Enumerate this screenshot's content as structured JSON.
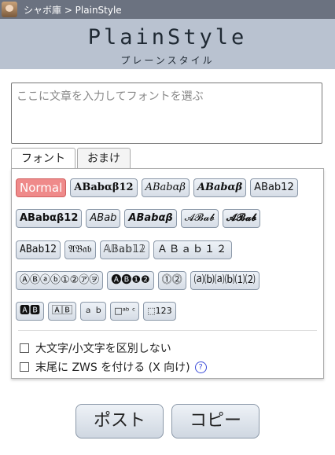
{
  "header": {
    "breadcrumb": "シャボ庫 > PlainStyle",
    "logo": "PlainStyle",
    "logo_sub": "プレーンスタイル"
  },
  "input": {
    "placeholder": "ここに文章を入力してフォントを選ぶ"
  },
  "tabs": [
    {
      "label": "フォント",
      "active": true
    },
    {
      "label": "おまけ",
      "active": false
    }
  ],
  "styles": {
    "row1": [
      "Normal",
      "ABabαβ12",
      "ABabαβ",
      "ABabαβ",
      "ABab12"
    ],
    "row2": [
      "ABabαβ12",
      "ABab",
      "ABabαβ",
      "𝓐𝓑𝓪𝓫",
      "𝓐𝓑𝓪𝓫"
    ],
    "row3": [
      "ABab12",
      "𝔄𝔅𝔞𝔟",
      "𝔸𝔹𝕒𝕓𝟙𝟚",
      "ＡＢａｂ１２"
    ],
    "row4": [
      "ⒶⒷⓐⓑ①②㋐㋾",
      "🅐🅑❶❷",
      "⓵⓶",
      "⒜⒝⒜⒝⑴⑵"
    ],
    "row5": [
      "🅰🅱",
      "🄰🄱",
      "ａ ｂ",
      "□ᵃᵇ ᶜ",
      "⬚123"
    ]
  },
  "options": {
    "ignore_case": "大文字/小文字を区別しない",
    "append_zws": "末尾に ZWS を付ける (X 向け)",
    "help_icon": "?"
  },
  "buttons": {
    "post": "ポスト",
    "copy": "コピー"
  },
  "colors": {
    "selected_chip": "#ef8a8a",
    "header_bg": "#b9c2d0",
    "topbar_bg": "#6b7280"
  }
}
